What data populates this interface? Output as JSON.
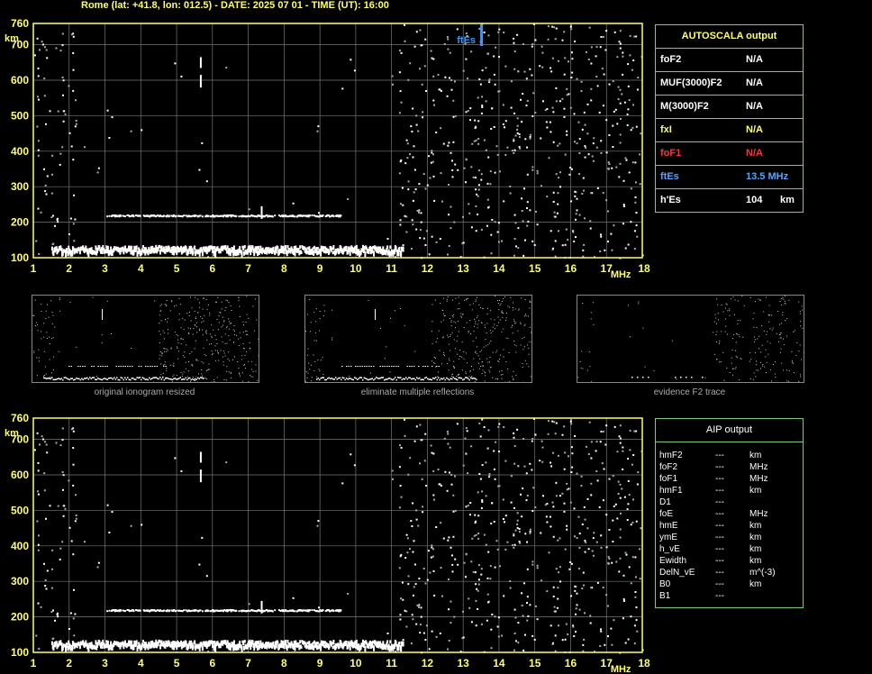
{
  "header": {
    "title": "Rome (lat: +41.8, lon: 012.5) - DATE: 2025 07 01 - TIME (UT): 16:00"
  },
  "chart_data": [
    {
      "type": "scatter",
      "xlabel": "MHz",
      "ylabel": "km",
      "xlim": [
        1,
        18
      ],
      "ylim": [
        100,
        760
      ],
      "x_ticks": [
        "1",
        "2",
        "3",
        "4",
        "5",
        "6",
        "7",
        "8",
        "9",
        "10",
        "11",
        "12",
        "13",
        "14",
        "15",
        "16",
        "17",
        "18"
      ],
      "y_ticks": [
        "100",
        "200",
        "300",
        "400",
        "500",
        "600",
        "700",
        "760"
      ],
      "grid": true,
      "annotation": {
        "label": "ftEs",
        "x": 13.5,
        "y": 760
      },
      "traces": [
        {
          "from_x": 1.5,
          "to_x": 11.3,
          "y": 118
        },
        {
          "from_x": 3.0,
          "to_x": 9.6,
          "y": 218
        }
      ]
    },
    {
      "type": "scatter",
      "xlabel": "MHz",
      "ylabel": "km",
      "xlim": [
        1,
        18
      ],
      "ylim": [
        100,
        760
      ],
      "x_ticks": [
        "1",
        "2",
        "3",
        "4",
        "5",
        "6",
        "7",
        "8",
        "9",
        "10",
        "11",
        "12",
        "13",
        "14",
        "15",
        "16",
        "17",
        "18"
      ],
      "y_ticks": [
        "100",
        "200",
        "300",
        "400",
        "500",
        "600",
        "700",
        "760"
      ],
      "grid": true,
      "traces": [
        {
          "from_x": 1.5,
          "to_x": 11.3,
          "y": 118
        },
        {
          "from_x": 3.0,
          "to_x": 9.6,
          "y": 218
        }
      ]
    }
  ],
  "autoscala": {
    "title": "AUTOSCALA output",
    "rows": [
      {
        "key": "foF2",
        "value": "N/A",
        "unit": "",
        "color": "#ffffff"
      },
      {
        "key": "MUF(3000)F2",
        "value": "N/A",
        "unit": "",
        "color": "#ffffff"
      },
      {
        "key": "M(3000)F2",
        "value": "N/A",
        "unit": "",
        "color": "#ffffff"
      },
      {
        "key": "fxI",
        "value": "N/A",
        "unit": "",
        "color": "#ffff66"
      },
      {
        "key": "foF1",
        "value": "N/A",
        "unit": "",
        "color": "#ff3333"
      },
      {
        "key": "ftEs",
        "value": "13.5 MHz",
        "unit": "",
        "color": "#4da6ff"
      },
      {
        "key": "h'Es",
        "value": "104",
        "unit": "km",
        "color": "#ffffff"
      }
    ]
  },
  "thumbnails": [
    {
      "caption": "original ionogram resized"
    },
    {
      "caption": "eliminate multiple reflections"
    },
    {
      "caption": "evidence F2 trace"
    }
  ],
  "aip": {
    "title": "AIP output",
    "rows": [
      {
        "key": "hmF2",
        "value": "---",
        "unit": "km"
      },
      {
        "key": "foF2",
        "value": "---",
        "unit": "MHz"
      },
      {
        "key": "foF1",
        "value": "---",
        "unit": "MHz"
      },
      {
        "key": "hmF1",
        "value": "---",
        "unit": "km"
      },
      {
        "key": "D1",
        "value": "---",
        "unit": ""
      },
      {
        "key": "foE",
        "value": "---",
        "unit": "MHz"
      },
      {
        "key": "hmE",
        "value": "---",
        "unit": "km"
      },
      {
        "key": "ymE",
        "value": "---",
        "unit": "km"
      },
      {
        "key": "h_vE",
        "value": "---",
        "unit": "km"
      },
      {
        "key": "Ewidth",
        "value": "---",
        "unit": "km"
      },
      {
        "key": "DelN_vE",
        "value": "---",
        "unit": "m^(-3)"
      },
      {
        "key": "B0",
        "value": "---",
        "unit": "km"
      },
      {
        "key": "B1",
        "value": "---",
        "unit": ""
      }
    ]
  }
}
